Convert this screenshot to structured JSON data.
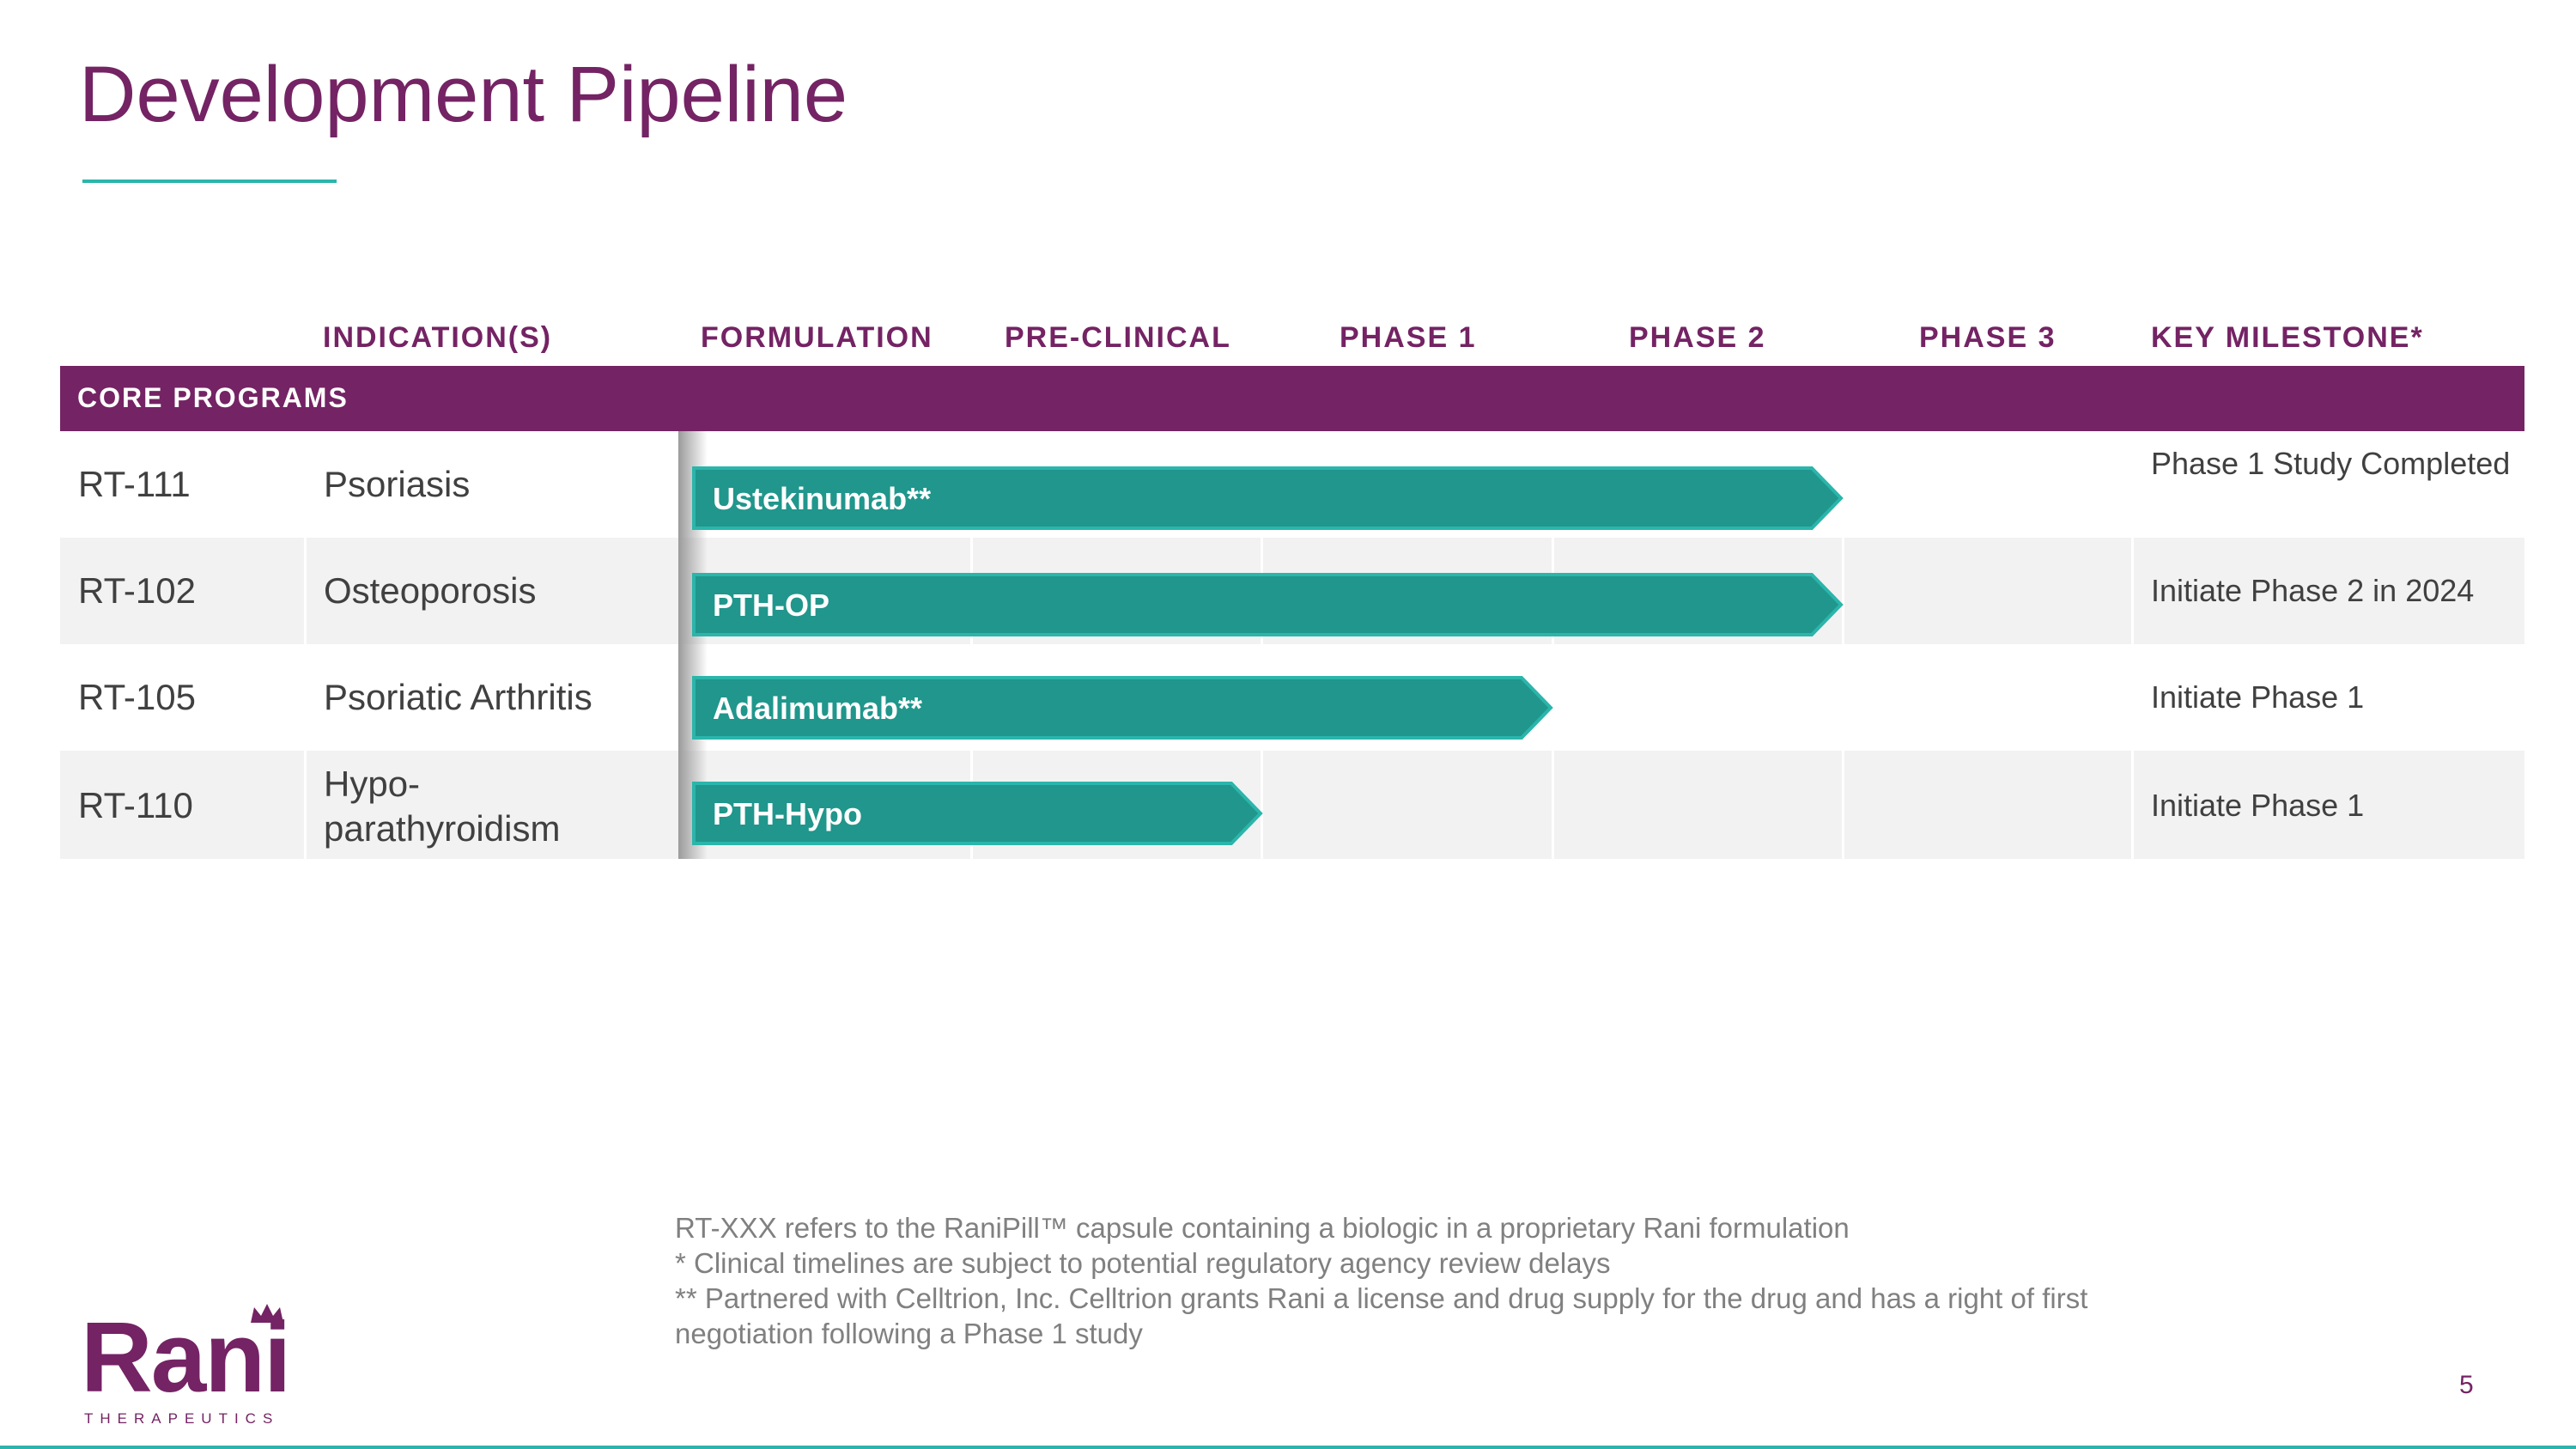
{
  "page": {
    "title": "Development Pipeline",
    "page_number": "5"
  },
  "table": {
    "headers": {
      "indication": "INDICATION(S)",
      "formulation": "FORMULATION",
      "preclinical": "PRE-CLINICAL",
      "phase1": "PHASE 1",
      "phase2": "PHASE 2",
      "phase3": "PHASE 3",
      "milestone": "KEY MILESTONE*"
    },
    "section": "CORE PROGRAMS",
    "rows": [
      {
        "id": "RT-111",
        "indication": "Psoriasis",
        "drug": "Ustekinumab**",
        "milestone": "Phase 1 Study Completed",
        "stage_extent": 3
      },
      {
        "id": "RT-102",
        "indication": "Osteoporosis",
        "drug": "PTH-OP",
        "milestone": "Initiate Phase 2 in 2024",
        "stage_extent": 3
      },
      {
        "id": "RT-105",
        "indication": "Psoriatic Arthritis",
        "drug": "Adalimumab**",
        "milestone": "Initiate Phase 1",
        "stage_extent": 2
      },
      {
        "id": "RT-110",
        "indication": "Hypo-parathyroidism",
        "indication_line1": "Hypo-",
        "indication_line2": "parathyroidism",
        "drug": "PTH-Hypo",
        "milestone": "Initiate Phase 1",
        "stage_extent": 1
      }
    ]
  },
  "footnotes": {
    "line1": "RT-XXX refers to the RaniPill™ capsule containing a biologic in a proprietary Rani formulation",
    "line2": "* Clinical timelines are subject to potential regulatory agency review delays",
    "line3": "** Partnered with Celltrion, Inc. Celltrion grants Rani a license and drug supply for the drug and has a right of first",
    "line4": "negotiation following a Phase 1 study"
  },
  "logo": {
    "name": "Rani",
    "tagline": "THERAPEUTICS"
  },
  "colors": {
    "brand_purple": "#742364",
    "bar_teal": "#20968c",
    "accent_teal": "#2bb5ab",
    "row_shade": "#f2f2f2"
  }
}
